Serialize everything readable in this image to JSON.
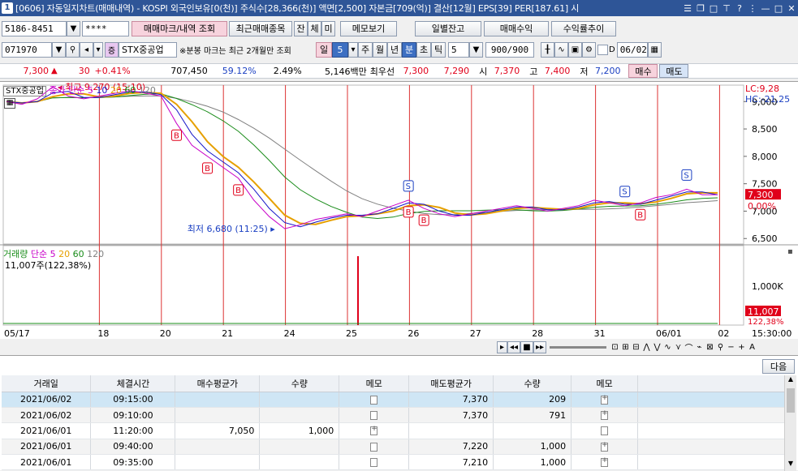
{
  "title": {
    "icon_label": "1",
    "text": "[0606] 자동일지차트(매매내역) - KOSPI 외국인보유[0(천)] 주식수[28,366(천)] 액면[2,500] 자본금[709(억)] 결산[12월] EPS[39] PER[187.61] 시"
  },
  "toolbar1": {
    "account": "5186-8451",
    "password": "****",
    "btn_trade_mark": "매매마크/내역 조회",
    "btn_recent": "최근매매종목",
    "btn_jan": "잔",
    "btn_che": "체",
    "btn_mi": "미",
    "btn_memo": "메모보기",
    "btn_daily": "일별잔고",
    "btn_profit": "매매수익",
    "btn_yield": "수익률추이"
  },
  "toolbar2": {
    "code": "071970",
    "name": "STX중공업",
    "note": "※분봉 마크는 최근 2개월만 조회",
    "period_il": "일",
    "period_num": "5",
    "period_ju": "주",
    "period_wol": "월",
    "period_nyeon": "년",
    "period_bun": "분",
    "period_cho": "초",
    "period_tik": "틱",
    "interval": "5",
    "count": "900/900",
    "date": "06/02"
  },
  "quote": {
    "price": "7,300",
    "change": "30",
    "change_pct": "+0.41%",
    "volume": "707,450",
    "ratio": "59.12%",
    "turnover": "2.49%",
    "amount": "5,146백만",
    "best_label": "최우선",
    "ask": "7,300",
    "bid": "7,290",
    "open_label": "시",
    "open": "7,370",
    "high_label": "고",
    "high": "7,400",
    "low_label": "저",
    "low": "7,200",
    "buy": "매수",
    "sell": "매도"
  },
  "chart_legend": {
    "stock": "STX중공업",
    "price_series": "종가",
    "ma_label": "단순",
    "ma_periods": [
      "5",
      "10",
      "20",
      "60",
      "120"
    ],
    "volume_label": "거래량",
    "volume_ma_label": "단순",
    "volume_ma_periods": [
      "5",
      "20",
      "60",
      "120"
    ],
    "volume_value": "11,007주(122,38%)"
  },
  "colors": {
    "ma5": "#c800c8",
    "ma10": "#1414c8",
    "ma20": "#e6a000",
    "ma60": "#1a8c1a",
    "ma120": "#808080",
    "up": "#e0001a",
    "down": "#1a3fc2",
    "mark_buy": "#e0001a",
    "mark_sell": "#1a3fc2"
  },
  "chart_data": {
    "type": "line",
    "title": "",
    "price_axis": {
      "ticks": [
        "9,000",
        "8,500",
        "8,000",
        "7,500",
        "7,000",
        "6,500"
      ],
      "range": [
        6400,
        9300
      ]
    },
    "volume_axis": {
      "ticks": [
        "1,000K"
      ]
    },
    "right_labels": {
      "lc": "LC:9,28",
      "hc": "HC:-21,25",
      "price_tag": "7,300",
      "pct_tag": "0,00%",
      "vol_tag": "11,007",
      "vol_pct_tag": "122,38%"
    },
    "x_labels": [
      "05/17",
      "18",
      "20",
      "21",
      "24",
      "25",
      "26",
      "27",
      "28",
      "31",
      "06/01",
      "02",
      "15:30:00"
    ],
    "annotations": {
      "max": "최고 9,270 (15:10)",
      "min": "최저 6,680 (11:25)"
    },
    "series_price": [
      9000,
      8950,
      9050,
      9270,
      9100,
      9050,
      9100,
      9150,
      9200,
      9150,
      9100,
      8600,
      8200,
      8000,
      7800,
      7600,
      7200,
      6900,
      6680,
      6750,
      6850,
      6900,
      6950,
      6900,
      7000,
      7100,
      7200,
      7050,
      6950,
      6900,
      6950,
      7000,
      7050,
      7100,
      7050,
      7000,
      7050,
      7100,
      7200,
      7150,
      7100,
      7150,
      7250,
      7300,
      7400,
      7300,
      7300
    ],
    "marks": [
      {
        "type": "B",
        "label": "B"
      },
      {
        "type": "B",
        "label": "B"
      },
      {
        "type": "B",
        "label": "B"
      },
      {
        "type": "S",
        "label": "S"
      },
      {
        "type": "B",
        "label": "B"
      },
      {
        "type": "B",
        "label": "B"
      },
      {
        "type": "S",
        "label": "S"
      },
      {
        "type": "B",
        "label": "B"
      },
      {
        "type": "S",
        "label": "S"
      }
    ]
  },
  "footer": {
    "next": "다음"
  },
  "table": {
    "headers": [
      "거래일",
      "체결시간",
      "매수평균가",
      "수량",
      "메모",
      "매도평균가",
      "수량",
      "메모"
    ],
    "rows": [
      {
        "date": "2021/06/02",
        "time": "09:15:00",
        "buy_avg": "",
        "buy_qty": "",
        "sell_avg": "7,370",
        "sell_qty": "209"
      },
      {
        "date": "2021/06/02",
        "time": "09:10:00",
        "buy_avg": "",
        "buy_qty": "",
        "sell_avg": "7,370",
        "sell_qty": "791"
      },
      {
        "date": "2021/06/01",
        "time": "11:20:00",
        "buy_avg": "7,050",
        "buy_qty": "1,000",
        "sell_avg": "",
        "sell_qty": ""
      },
      {
        "date": "2021/06/01",
        "time": "09:40:00",
        "buy_avg": "",
        "buy_qty": "",
        "sell_avg": "7,220",
        "sell_qty": "1,000"
      },
      {
        "date": "2021/06/01",
        "time": "09:35:00",
        "buy_avg": "",
        "buy_qty": "",
        "sell_avg": "7,210",
        "sell_qty": "1,000"
      }
    ]
  }
}
